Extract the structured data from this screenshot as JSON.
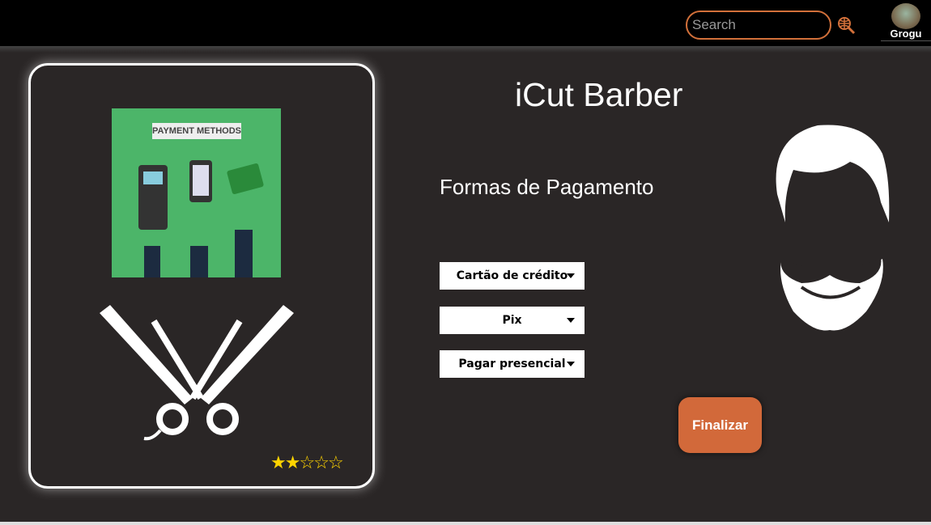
{
  "header": {
    "search_placeholder": "Search",
    "user_name": "Grogu",
    "accent": "#d2703a"
  },
  "card": {
    "image_label": "PAYMENT METHODS",
    "rating": 2,
    "rating_max": 5
  },
  "main": {
    "title": "iCut Barber",
    "subtitle": "Formas de Pagamento",
    "selects": [
      {
        "value": "Cartão de crédito"
      },
      {
        "value": "Pix"
      },
      {
        "value": "Pagar presencial"
      }
    ],
    "finish_label": "Finalizar"
  }
}
